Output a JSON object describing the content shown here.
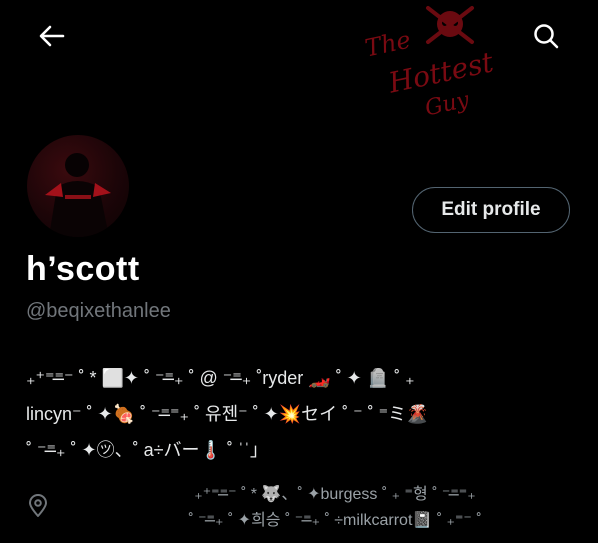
{
  "header": {
    "back_icon": "arrow-left-icon",
    "search_icon": "search-icon"
  },
  "banner": {
    "line1": "The",
    "line2": "Hottest",
    "line3": "Guy"
  },
  "profile": {
    "edit_button_label": "Edit profile",
    "display_name": "h’scott",
    "handle": "@beqixethanlee",
    "bio_lines": [
      "₊⁺⁼⁼̶⁻ ˚ * ⬜✦ ˚ ⁻⁼̶₊ ˚ @ ⁻⁼̶₊ ˚ryder 🏎️ ˚ ✦ 🪦 ˚ ₊",
      "lincyn⁻ ˚ ✦🍖 ˚ ⁻⁼̶⁼₊ ˚ 유젠⁻ ˚ ✦💥セイ ˚ ⁻ ˚ ⁼ミ🌋",
      "˚ ⁻⁼̶₊ ˚ ✦㋡、˚ a÷バー🌡️ ˚ ˈˈ」"
    ],
    "location_lines": [
      "₊⁺⁼⁼̶⁻ ˚ * 🐺、˚ ✦burgess ˚ ₊ ⁼형 ˚ ⁻⁼̶⁼₊",
      "˚ ⁻⁼̶₊ ˚ ✦희승 ˚ ⁻⁼̶₊ ˚ ÷milkcarrot📓 ˚ ₊⁼⁻ ˚"
    ],
    "location_icon": "location-pin-icon"
  },
  "colors": {
    "background": "#000000",
    "text_primary": "#e7e9ea",
    "text_secondary": "#71767b",
    "button_border": "#536471",
    "banner_accent": "#7a0a12"
  }
}
